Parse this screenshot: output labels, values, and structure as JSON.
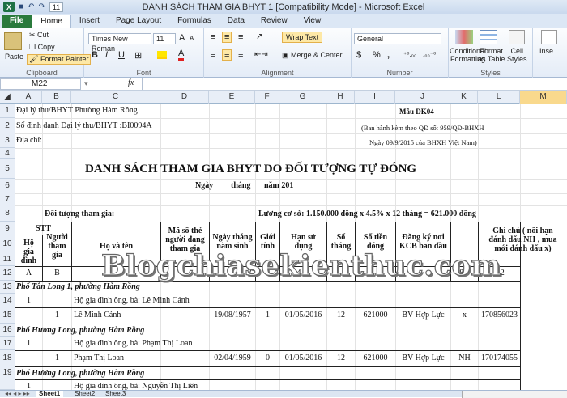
{
  "window": {
    "title": "DANH SÁCH THAM GIA BHYT 1  [Compatibility Mode]  -  Microsoft Excel",
    "qat_value": "11"
  },
  "tabs": [
    "File",
    "Home",
    "Insert",
    "Page Layout",
    "Formulas",
    "Data",
    "Review",
    "View"
  ],
  "ribbon": {
    "clipboard": {
      "paste": "Paste",
      "cut": "Cut",
      "copy": "Copy",
      "format_painter": "Format Painter",
      "label": "Clipboard"
    },
    "font": {
      "name": "Times New Roman",
      "size": "11",
      "label": "Font",
      "bold": "B",
      "italic": "I",
      "underline": "U",
      "grow": "A",
      "shrink": "A",
      "font_color": "A"
    },
    "alignment": {
      "wrap": "Wrap Text",
      "merge": "Merge & Center",
      "label": "Alignment"
    },
    "number": {
      "format": "General",
      "currency": "$",
      "percent": "%",
      "comma": ",",
      "label": "Number"
    },
    "styles": {
      "conditional": "Conditional",
      "conditional2": "Formatting",
      "format_table": "Format",
      "format_table2": "as Table",
      "cell_styles": "Cell",
      "cell_styles2": "Styles",
      "label": "Styles"
    },
    "cells": {
      "insert": "Inse"
    }
  },
  "formula_bar": {
    "name_box": "M22",
    "fx": "fx",
    "value": ""
  },
  "columns": [
    "A",
    "B",
    "C",
    "D",
    "E",
    "F",
    "G",
    "H",
    "I",
    "J",
    "K",
    "L",
    "M"
  ],
  "rows": [
    "1",
    "2",
    "3",
    "4",
    "5",
    "6",
    "7",
    "8",
    "9",
    "10",
    "11",
    "12",
    "13",
    "14",
    "15",
    "16",
    "17",
    "18",
    "19"
  ],
  "sheet": {
    "r1a": "Đại lý thu/BHYT Phường Hàm Rồng",
    "r1j": "Mẫu DK04",
    "r2a": "Số định danh Đại lý thu/BHYT :BI0094A",
    "r2j": "(Ban hành kèm theo QĐ số: 959/QĐ-BHXH",
    "r3a": "Địa chỉ:",
    "r3j": "Ngày 09/9/2015 của BHXH Việt Nam)",
    "title": "DANH SÁCH THAM GIA BHYT DO ĐỐI TƯỢNG TỰ ĐÓNG",
    "date_ngay": "Ngày",
    "date_thang": "tháng",
    "date_nam": "năm 201",
    "doi_tuong": "Đối tượng tham gia:",
    "luong": "Lương cơ sở: 1.150.000 đồng x 4.5% x 12 tháng = 621.000 đồng",
    "stt": "STT",
    "h_a1": "Hộ",
    "h_a2": "gia",
    "h_a3": "đình",
    "h_b1": "Người",
    "h_b2": "tham",
    "h_b3": "gia",
    "h_c": "Họ và tên",
    "h_d1": "Mã số thẻ",
    "h_d2": "người đang",
    "h_d3": "tham gia",
    "h_e1": "Ngày tháng",
    "h_e2": "năm sinh",
    "h_f1": "Giới",
    "h_f2": "tính",
    "h_g1": "Hạn sử",
    "h_g2": "dụng",
    "h_h1": "Số",
    "h_h2": "tháng",
    "h_i1": "Số tiền",
    "h_i2": "đóng",
    "h_j1": "Đăng ký nơi",
    "h_j2": "KCB ban đầu",
    "h_l1": "Ghi chú ( nối hạn",
    "h_l2": "đánh dấu NH , mua",
    "h_l3": "mới đánh dấu x)",
    "r12a": "A",
    "r12b": "B",
    "r12e": "3",
    "r12g": "4",
    "r12k": "8,1",
    "r12l": "8,2",
    "r13": "Phố Tân Long 1, phường Hàm Rồng",
    "r14a": "1",
    "r14c": "Hộ gia đình ông, bà: Lê Minh Cảnh",
    "r15b": "1",
    "r15c": "Lê Minh Cảnh",
    "r15e": "19/08/1957",
    "r15f": "1",
    "r15g": "01/05/2016",
    "r15h": "12",
    "r15i": "621000",
    "r15j": "BV Hợp Lực",
    "r15k": "x",
    "r15l": "170856023",
    "r16": "Phố Hương Long, phường Hàm Rồng",
    "r17a": "1",
    "r17c": "Hộ gia đình ông, bà: Phạm Thị Loan",
    "r18b": "1",
    "r18c": "Phạm Thị Loan",
    "r18e": "02/04/1959",
    "r18f": "0",
    "r18g": "01/05/2016",
    "r18h": "12",
    "r18i": "621000",
    "r18j": "BV Hợp Lực",
    "r18k": "NH",
    "r18l": "170174055",
    "r19": "Phố Hương Long, phường Hàm Rồng",
    "r20a": "1",
    "r20c": "Hộ gia đình ông, bà: Nguyễn Thị Liên"
  },
  "watermark": "Blogchiasekienthuc.com",
  "sheet_tabs": [
    "Sheet1",
    "Sheet2",
    "Sheet3"
  ]
}
